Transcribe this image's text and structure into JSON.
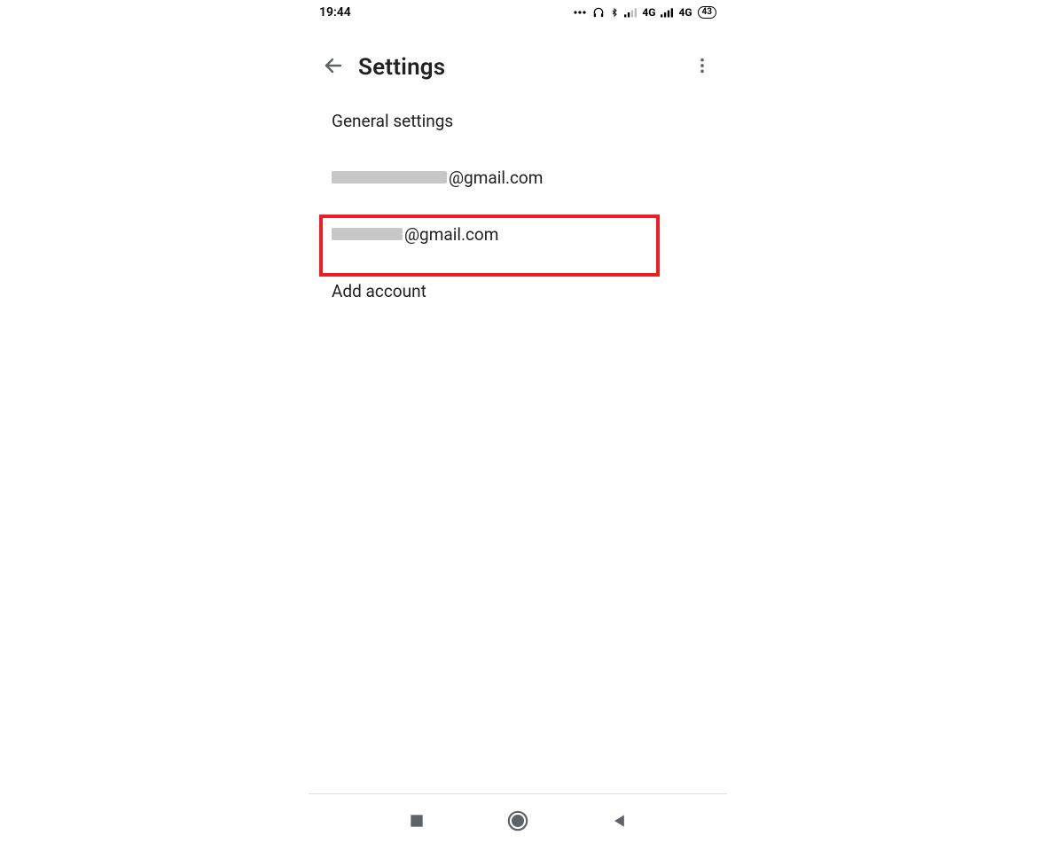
{
  "statusbar": {
    "time": "19:44",
    "net1": "4G",
    "net2": "4G",
    "battery": "43"
  },
  "appbar": {
    "title": "Settings"
  },
  "list": {
    "general": "General settings",
    "account1_suffix": "@gmail.com",
    "account2_suffix": "@gmail.com",
    "add": "Add account"
  }
}
